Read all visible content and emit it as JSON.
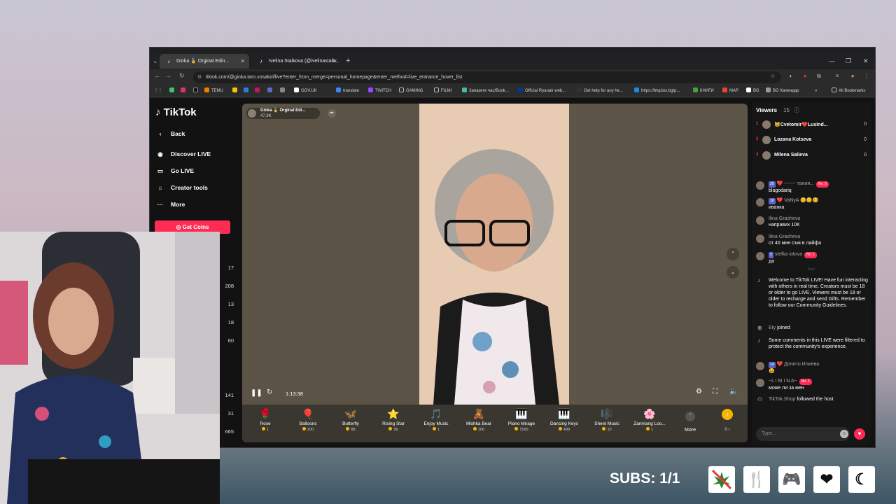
{
  "browser": {
    "tabs": [
      {
        "label": "Ginka 🏅 Orginal Edin..."
      },
      {
        "label": "Ivelina Staikova (@ivelinastaik..."
      }
    ],
    "url": "tiktok.com/@ginka.taro.vosakol/live?enter_from_merge=personal_homepage&enter_method=live_entrance_hover_list",
    "bookmarks": [
      "TEMU",
      "GOV.UK",
      "translate",
      "TWITCH",
      "GAMING",
      "FILMI",
      "Запазете час/Book...",
      "Official Ryanair web...",
      "Get help for any he...",
      "https://btvplus.bg/p...",
      "КНИГИ",
      "MAP",
      "BG Календар",
      "All Bookmarks"
    ]
  },
  "tiktok": {
    "logo": "TikTok",
    "nav": {
      "back": "Back",
      "discover": "Discover LIVE",
      "go_live": "Go LIVE",
      "creator_tools": "Creator tools",
      "more": "More",
      "get_coins": "Get Coins"
    },
    "side_counts": [
      "17",
      "208",
      "13",
      "18",
      "60",
      "141",
      "31",
      "665"
    ],
    "host": {
      "name": "Ginka 🏅 Orginal Edi...",
      "likes": "47,9K"
    },
    "stream_time": "1:13:38",
    "gifts": [
      {
        "name": "Rose",
        "price": "1",
        "icon": "🌹"
      },
      {
        "name": "Balloons",
        "price": "200",
        "icon": "🎈"
      },
      {
        "name": "Butterfly",
        "price": "88",
        "icon": "🦋"
      },
      {
        "name": "Rising Star",
        "price": "99",
        "icon": "⭐"
      },
      {
        "name": "Enjoy Music",
        "price": "1",
        "icon": "🎵"
      },
      {
        "name": "Mishka Bear",
        "price": "100",
        "icon": "🧸"
      },
      {
        "name": "Piano Mirage",
        "price": "1500",
        "icon": "🎹"
      },
      {
        "name": "Dancing Keys",
        "price": "499",
        "icon": "🎹"
      },
      {
        "name": "Sheet Music",
        "price": "10",
        "icon": "🎼"
      },
      {
        "name": "Zanmang Loo...",
        "price": "1",
        "icon": "🌸"
      }
    ],
    "gift_more": "More",
    "coin_balance": "0 ›"
  },
  "chat": {
    "viewers_title": "Viewers",
    "viewers_count": "· 15",
    "top_viewers": [
      {
        "rank": "1",
        "name": "🐱Cvetomir❤️Lusind...",
        "score": "0"
      },
      {
        "rank": "2",
        "name": "Lozana Kotseva",
        "score": "0"
      },
      {
        "rank": "3",
        "name": "Milena Salieva",
        "score": "0"
      }
    ],
    "messages": [
      {
        "level": "26",
        "user": "❤️ ~~~~ тания...",
        "no": "No. 2",
        "text": "blagodariq"
      },
      {
        "level": "16",
        "user": "❤️ VaNyA 😊😊😊",
        "no": "",
        "text": "иванка"
      },
      {
        "level": "",
        "user": "Ilina Grasheva",
        "no": "",
        "text": "направих 10К"
      },
      {
        "level": "",
        "user": "Ilina Grasheva",
        "no": "",
        "text": "от 40 мин съм в лайфа"
      },
      {
        "level": "9",
        "user": "stefka iotova",
        "no": "No. 1",
        "text": "да"
      }
    ],
    "new_label": "New",
    "welcome": "Welcome to TikTok LIVE! Have fun interacting with others in real time. Creators must be 18 or older to go LIVE. Viewers must be 18 or older to recharge and send Gifts. Remember to follow our Community Guidelines.",
    "joined_user": "Ety",
    "joined_text": "joined",
    "filtered": "Some comments in this LIVE were filtered to protect the community's experience.",
    "messages2": [
      {
        "level": "14",
        "user": "❤️ Донито Илиева",
        "no": "",
        "text": "😆"
      },
      {
        "level": "",
        "user": "~L I M I N A~",
        "no": "No. 2",
        "text": "може ли за мен"
      }
    ],
    "shop_user": "TikTok.Shop",
    "shop_text": "followed the host",
    "input_placeholder": "Type..."
  },
  "overlay": {
    "subs_label": "SUBS: 1/1",
    "icons": [
      "no-weed-icon",
      "fork-knife-icon",
      "gamepad-icon",
      "heart-icon",
      "moon-icon"
    ]
  }
}
